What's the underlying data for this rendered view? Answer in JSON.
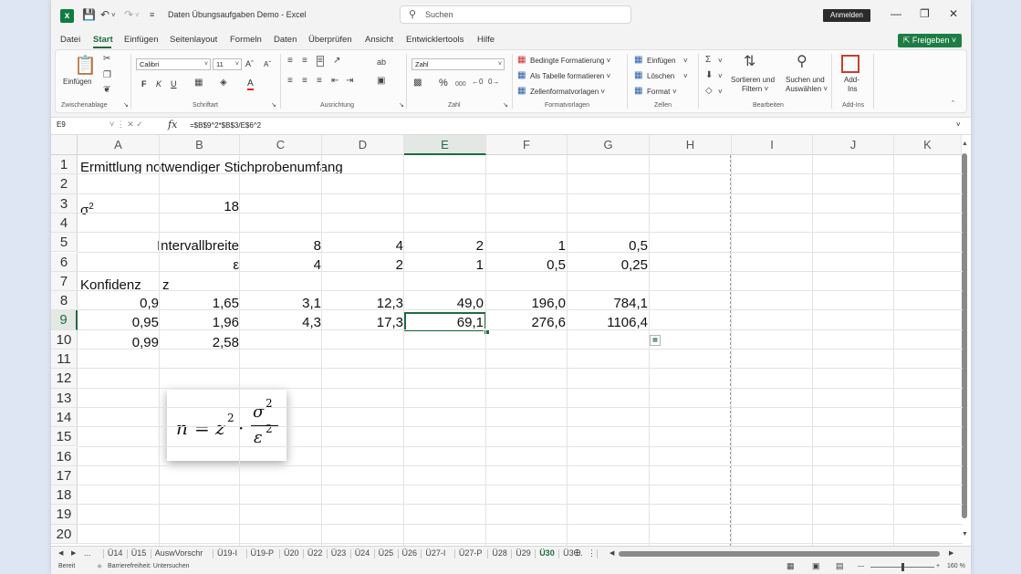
{
  "window": {
    "title": "Daten Übungsaufgaben Demo  -  Excel",
    "search_placeholder": "Suchen",
    "signin_label": "Anmelden",
    "share_label": "Freigeben"
  },
  "menu": [
    "Datei",
    "Start",
    "Einfügen",
    "Seitenlayout",
    "Formeln",
    "Daten",
    "Überprüfen",
    "Ansicht",
    "Entwicklertools",
    "Hilfe"
  ],
  "ribbon": {
    "clipboard": {
      "paste": "Einfügen",
      "label": "Zwischenablage"
    },
    "font": {
      "name": "Calibri",
      "size": "11",
      "bold": "F",
      "italic": "K",
      "underline": "U",
      "label": "Schriftart"
    },
    "alignment": {
      "label": "Ausrichtung"
    },
    "number": {
      "format": "Zahl",
      "percent": "%",
      "thousands": "000",
      "label": "Zahl"
    },
    "styles": {
      "conditional": "Bedingte Formatierung ˅",
      "as_table": "Als Tabelle formatieren ˅",
      "cell_styles": "Zellenformatvorlagen ˅",
      "label": "Formatvorlagen"
    },
    "cells": {
      "insert": "Einfügen",
      "delete": "Löschen",
      "format": "Format",
      "label": "Zellen"
    },
    "editing": {
      "sort_line1": "Sortieren und",
      "sort_line2": "Filtern ˅",
      "find_line1": "Suchen und",
      "find_line2": "Auswählen ˅",
      "label": "Bearbeiten"
    },
    "addins": {
      "line1": "Add-",
      "line2": "Ins",
      "label": "Add-Ins"
    }
  },
  "formula_bar": {
    "name_box": "E9",
    "fx": "fx",
    "formula": "=$B$9^2*$B$3/E$6^2"
  },
  "columns": [
    "A",
    "B",
    "C",
    "D",
    "E",
    "F",
    "G",
    "H",
    "I",
    "J",
    "K"
  ],
  "rows": [
    "1",
    "2",
    "3",
    "4",
    "5",
    "6",
    "7",
    "8",
    "9",
    "10",
    "11",
    "12",
    "13",
    "14",
    "15",
    "16",
    "17",
    "18",
    "19",
    "20"
  ],
  "cells": {
    "a1": "Ermittlung notwendiger Stichprobenumfang",
    "a3_base": "σ",
    "a3_exp": "2",
    "b3": "18",
    "b5": "Intervallbreite",
    "c5": "8",
    "d5": "4",
    "e5": "2",
    "f5": "1",
    "g5": "0,5",
    "b6": "ε",
    "c6": "4",
    "d6": "2",
    "e6": "1",
    "f6": "0,5",
    "g6": "0,25",
    "a7": "Konfidenz",
    "b7": "z",
    "a8": "0,9",
    "b8": "1,65",
    "c8": "3,1",
    "d8": "12,3",
    "e8": "49,0",
    "f8": "196,0",
    "g8": "784,1",
    "a9": "0,95",
    "b9": "1,96",
    "c9": "4,3",
    "d9": "17,3",
    "e9": "69,1",
    "f9": "276,6",
    "g9": "1106,4",
    "a10": "0,99",
    "b10": "2,58"
  },
  "formula_image": {
    "n": "n",
    "eq": "=",
    "z": "z",
    "sq": "2",
    "dot": "·",
    "sigma": "σ",
    "eps": "ε"
  },
  "sheet_tabs": [
    "...",
    "Ü14",
    "Ü15",
    "AuswVorschr",
    "Ü19-I",
    "Ü19-P",
    "Ü20",
    "Ü22",
    "Ü23",
    "Ü24",
    "Ü25",
    "Ü26",
    "Ü27-I",
    "Ü27-P",
    "Ü28",
    "Ü29",
    "Ü30",
    "Ü3 ..."
  ],
  "active_tab": "Ü30",
  "status": {
    "ready": "Bereit",
    "accessibility": "Barrierefreiheit: Untersuchen",
    "zoom": "160 %"
  },
  "colors": {
    "accent": "#1e6b3d",
    "excel_green": "#107c41"
  }
}
